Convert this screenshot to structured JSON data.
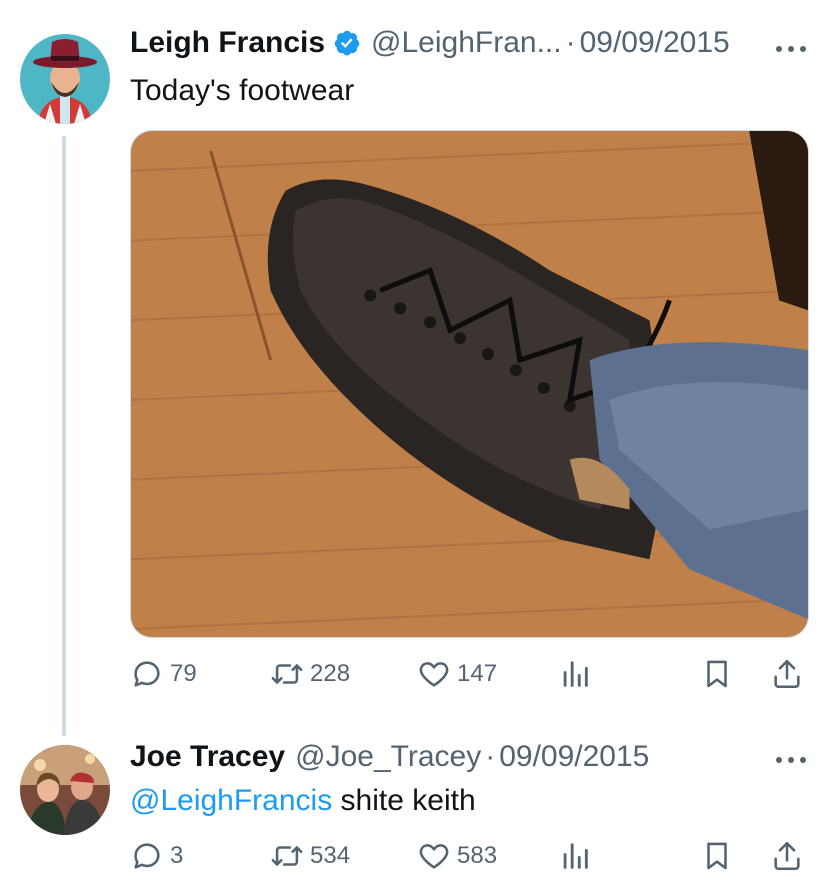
{
  "tweet": {
    "author_name": "Leigh Francis",
    "author_handle": "@LeighFran...",
    "separator": "·",
    "date": "09/09/2015",
    "text": "Today's footwear",
    "replies": "79",
    "retweets": "228",
    "likes": "147",
    "icons": [
      "verified-badge-icon",
      "more-icon",
      "reply-icon",
      "retweet-icon",
      "like-icon",
      "views-icon",
      "bookmark-icon",
      "share-icon"
    ]
  },
  "reply": {
    "author_name": "Joe Tracey",
    "author_handle": "@Joe_Tracey",
    "separator": "·",
    "date": "09/09/2015",
    "mention": "@LeighFrancis",
    "text": " shite keith",
    "replies": "3",
    "retweets": "534",
    "likes": "583"
  },
  "colors": {
    "text": "#0f1419",
    "secondary": "#536471",
    "link": "#1d9bf0",
    "thread_line": "#cfd9de",
    "verified": "#1d9bf0"
  }
}
